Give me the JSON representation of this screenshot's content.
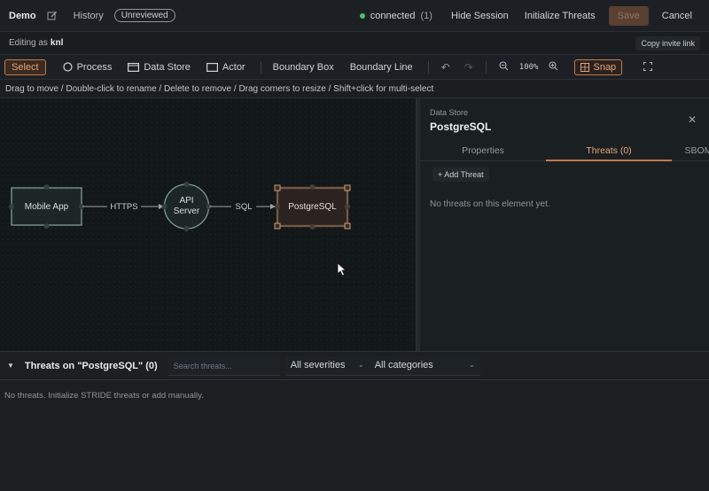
{
  "topbar": {
    "title": "Demo",
    "history": "History",
    "badge": "Unreviewed",
    "status": "connected",
    "count": "(1)",
    "hide_session": "Hide Session",
    "init_threats": "Initialize Threats",
    "save": "Save",
    "cancel": "Cancel"
  },
  "editbar": {
    "label": "Editing as",
    "user": "knl",
    "invite": "Copy invite link"
  },
  "toolbar": {
    "select": "Select",
    "process": "Process",
    "datastore": "Data Store",
    "actor": "Actor",
    "boundary_box": "Boundary Box",
    "boundary_line": "Boundary Line",
    "zoom": "100%",
    "snap": "Snap"
  },
  "hint": "Drag to move / Double-click to rename / Delete to remove / Drag corners to resize / Shift+click for multi-select",
  "diagram": {
    "nodes": {
      "mobile": "Mobile App",
      "api_line1": "API",
      "api_line2": "Server",
      "pg": "PostgreSQL"
    },
    "edges": {
      "https": "HTTPS",
      "sql": "SQL"
    }
  },
  "panel": {
    "kind": "Data Store",
    "title": "PostgreSQL",
    "tabs": [
      "Properties",
      "Threats (0)",
      "SBOM"
    ],
    "add_threat": "+ Add Threat",
    "empty": "No threats on this element yet."
  },
  "bottom": {
    "title": "Threats on \"PostgreSQL\" (0)",
    "search_placeholder": "Search threats...",
    "severity": "All severities",
    "category": "All categories",
    "empty": "No threats. Initialize STRIDE threats or add manually."
  },
  "colors": {
    "accent": "#c27a4a",
    "connected": "#4bc26b"
  }
}
